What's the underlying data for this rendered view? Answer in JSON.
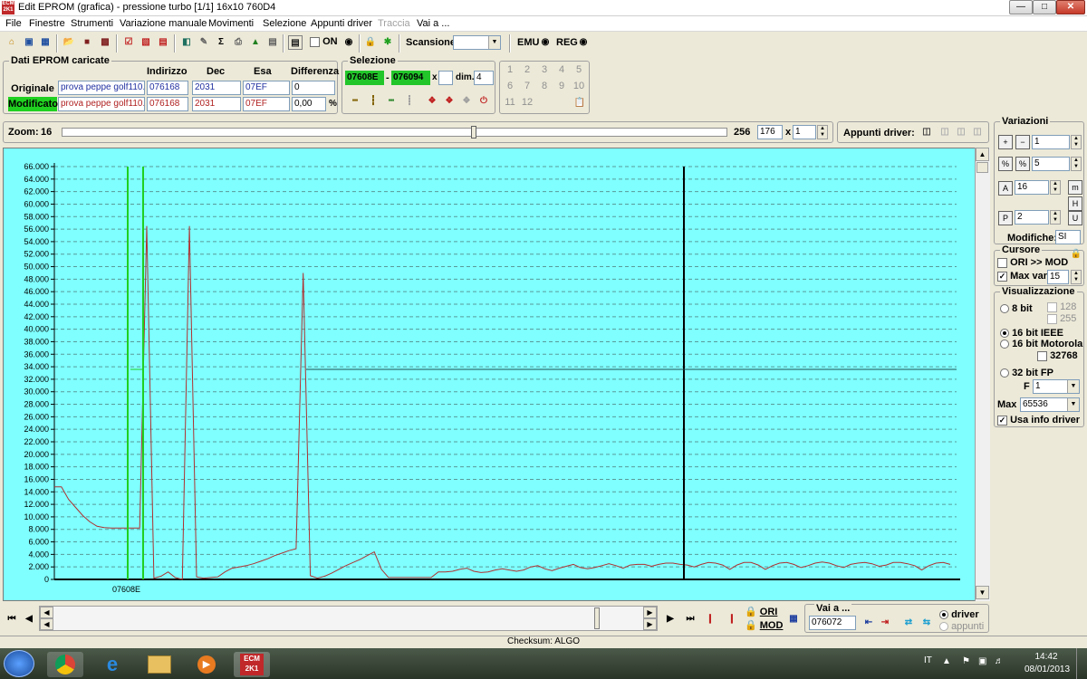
{
  "window": {
    "title": "Edit EPROM (grafica) - pressione turbo  [1/1]  16x10  760D4",
    "app_icon": "ecm-icon"
  },
  "menu": [
    {
      "label": "File",
      "enabled": true
    },
    {
      "label": "Finestre",
      "enabled": true
    },
    {
      "label": "Strumenti",
      "enabled": true
    },
    {
      "label": "Variazione manuale",
      "enabled": true
    },
    {
      "label": "Movimenti",
      "enabled": true
    },
    {
      "label": "Selezione",
      "enabled": true
    },
    {
      "label": "Appunti driver",
      "enabled": true
    },
    {
      "label": "Traccia",
      "enabled": false
    },
    {
      "label": "Vai a ...",
      "enabled": true
    }
  ],
  "toolbar": {
    "on_label": "ON",
    "on_checked": false,
    "scansione_label": "Scansione",
    "scansione_value": "",
    "emu_label": "EMU",
    "reg_label": "REG"
  },
  "eprom": {
    "title": "Dati EPROM caricate",
    "headers": [
      "Indirizzo",
      "Dec",
      "Esa",
      "Differenza"
    ],
    "rows": [
      {
        "label": "Originale",
        "file": "prova peppe golf110.t",
        "address": "076168",
        "dec": "2031",
        "hex": "07EF",
        "diff": "0",
        "unit": ""
      },
      {
        "label": "Modificato",
        "file": "prova peppe golf110.t",
        "address": "076168",
        "dec": "2031",
        "hex": "07EF",
        "diff": "0,00",
        "unit": "%"
      }
    ]
  },
  "selezione": {
    "title": "Selezione",
    "from": "07608E",
    "dash": "-",
    "to": "076094",
    "x_label": "x",
    "x_value": "",
    "dim_label": "dim.",
    "dim_value": "4"
  },
  "numpad": [
    "1",
    "2",
    "3",
    "4",
    "5",
    "6",
    "7",
    "8",
    "9",
    "10",
    "11",
    "12"
  ],
  "zoom": {
    "label": "Zoom:",
    "min": "16",
    "max": "256",
    "value": "176",
    "x_label": "x",
    "multiplier": "1",
    "slider_fraction": 0.62
  },
  "appunti": {
    "label": "Appunti driver:"
  },
  "variazioni": {
    "title": "Variazioni",
    "step1": "1",
    "step2": "5",
    "step3": "16",
    "step4": "2",
    "modifiche_label": "Modifiche:",
    "modifiche_value": "SI"
  },
  "cursore": {
    "title": "Cursore",
    "ori_mod_label": "ORI >> MOD",
    "ori_mod_checked": false,
    "maxvar_label": "Max var",
    "maxvar_checked": true,
    "maxvar_value": "15"
  },
  "visualizzazione": {
    "title": "Visualizzazione",
    "opt_8bit": "8 bit",
    "c128": "128",
    "c255": "255",
    "opt_16ieee": "16 bit IEEE",
    "opt_16moto": "16 bit Motorola",
    "c32768": "32768",
    "opt_32fp": "32 bit FP",
    "f_label": "F",
    "f_value": "1",
    "max_label": "Max",
    "max_value": "65536",
    "usa_label": "Usa info driver",
    "usa_checked": true,
    "selected": "16 bit IEEE"
  },
  "chart_data": {
    "type": "line",
    "ylim": [
      0,
      66000
    ],
    "y_ticks": [
      "0",
      "2.000",
      "4.000",
      "6.000",
      "8.000",
      "10.000",
      "12.000",
      "14.000",
      "16.000",
      "18.000",
      "20.000",
      "22.000",
      "24.000",
      "26.000",
      "28.000",
      "30.000",
      "32.000",
      "34.000",
      "36.000",
      "38.000",
      "40.000",
      "42.000",
      "44.000",
      "46.000",
      "48.000",
      "50.000",
      "52.000",
      "54.000",
      "56.000",
      "58.000",
      "60.000",
      "62.000",
      "64.000",
      "66.000"
    ],
    "x_label_marker": "07608E",
    "grid": true,
    "series": [
      {
        "values": [
          14800,
          14800,
          12800,
          11500,
          10200,
          9200,
          8500,
          8300,
          8200,
          8200,
          8200,
          8200,
          8200,
          56500,
          200,
          500,
          1200,
          300,
          0,
          56500,
          400,
          200,
          300,
          400,
          1200,
          1800,
          2000,
          2200,
          2500,
          2900,
          3300,
          3800,
          4200,
          4600,
          4900,
          49000,
          600,
          200,
          500,
          1000,
          1600,
          2200,
          2700,
          3200,
          3800,
          4400,
          1600,
          300,
          300,
          300,
          300,
          300,
          300,
          300,
          1200,
          1200,
          1300,
          1600,
          1800,
          1300,
          1100,
          1200,
          1500,
          1700,
          1500,
          1300,
          1500,
          2000,
          2200,
          1700,
          1400,
          1800,
          2100,
          2400,
          1900,
          1700,
          1900,
          2200,
          2500,
          2200,
          1800,
          2300,
          2400,
          2400,
          2100,
          2400,
          2600,
          2600,
          2400,
          2300,
          2000,
          2400,
          2700,
          2600,
          2300,
          1600,
          2300,
          2700,
          2700,
          2300,
          1600,
          2200,
          2600,
          2700,
          2400,
          1900,
          2200,
          2600,
          2800,
          2600,
          2200,
          1900,
          2400,
          2600,
          2700,
          2500,
          2100,
          2300,
          2700,
          2700,
          2500,
          2200,
          1500,
          2200,
          2600,
          2700,
          2400
        ]
      }
    ]
  },
  "nav": {
    "ori_label": "ORI",
    "mod_label": "MOD",
    "vai_title": "Vai a ...",
    "vai_value": "076072",
    "driver_label": "driver",
    "appunti_label": "appunti",
    "selected": "driver"
  },
  "status": {
    "checksum": "Checksum: ALGO"
  },
  "taskbar": {
    "lang": "IT",
    "time": "14:42",
    "date": "08/01/2013"
  }
}
